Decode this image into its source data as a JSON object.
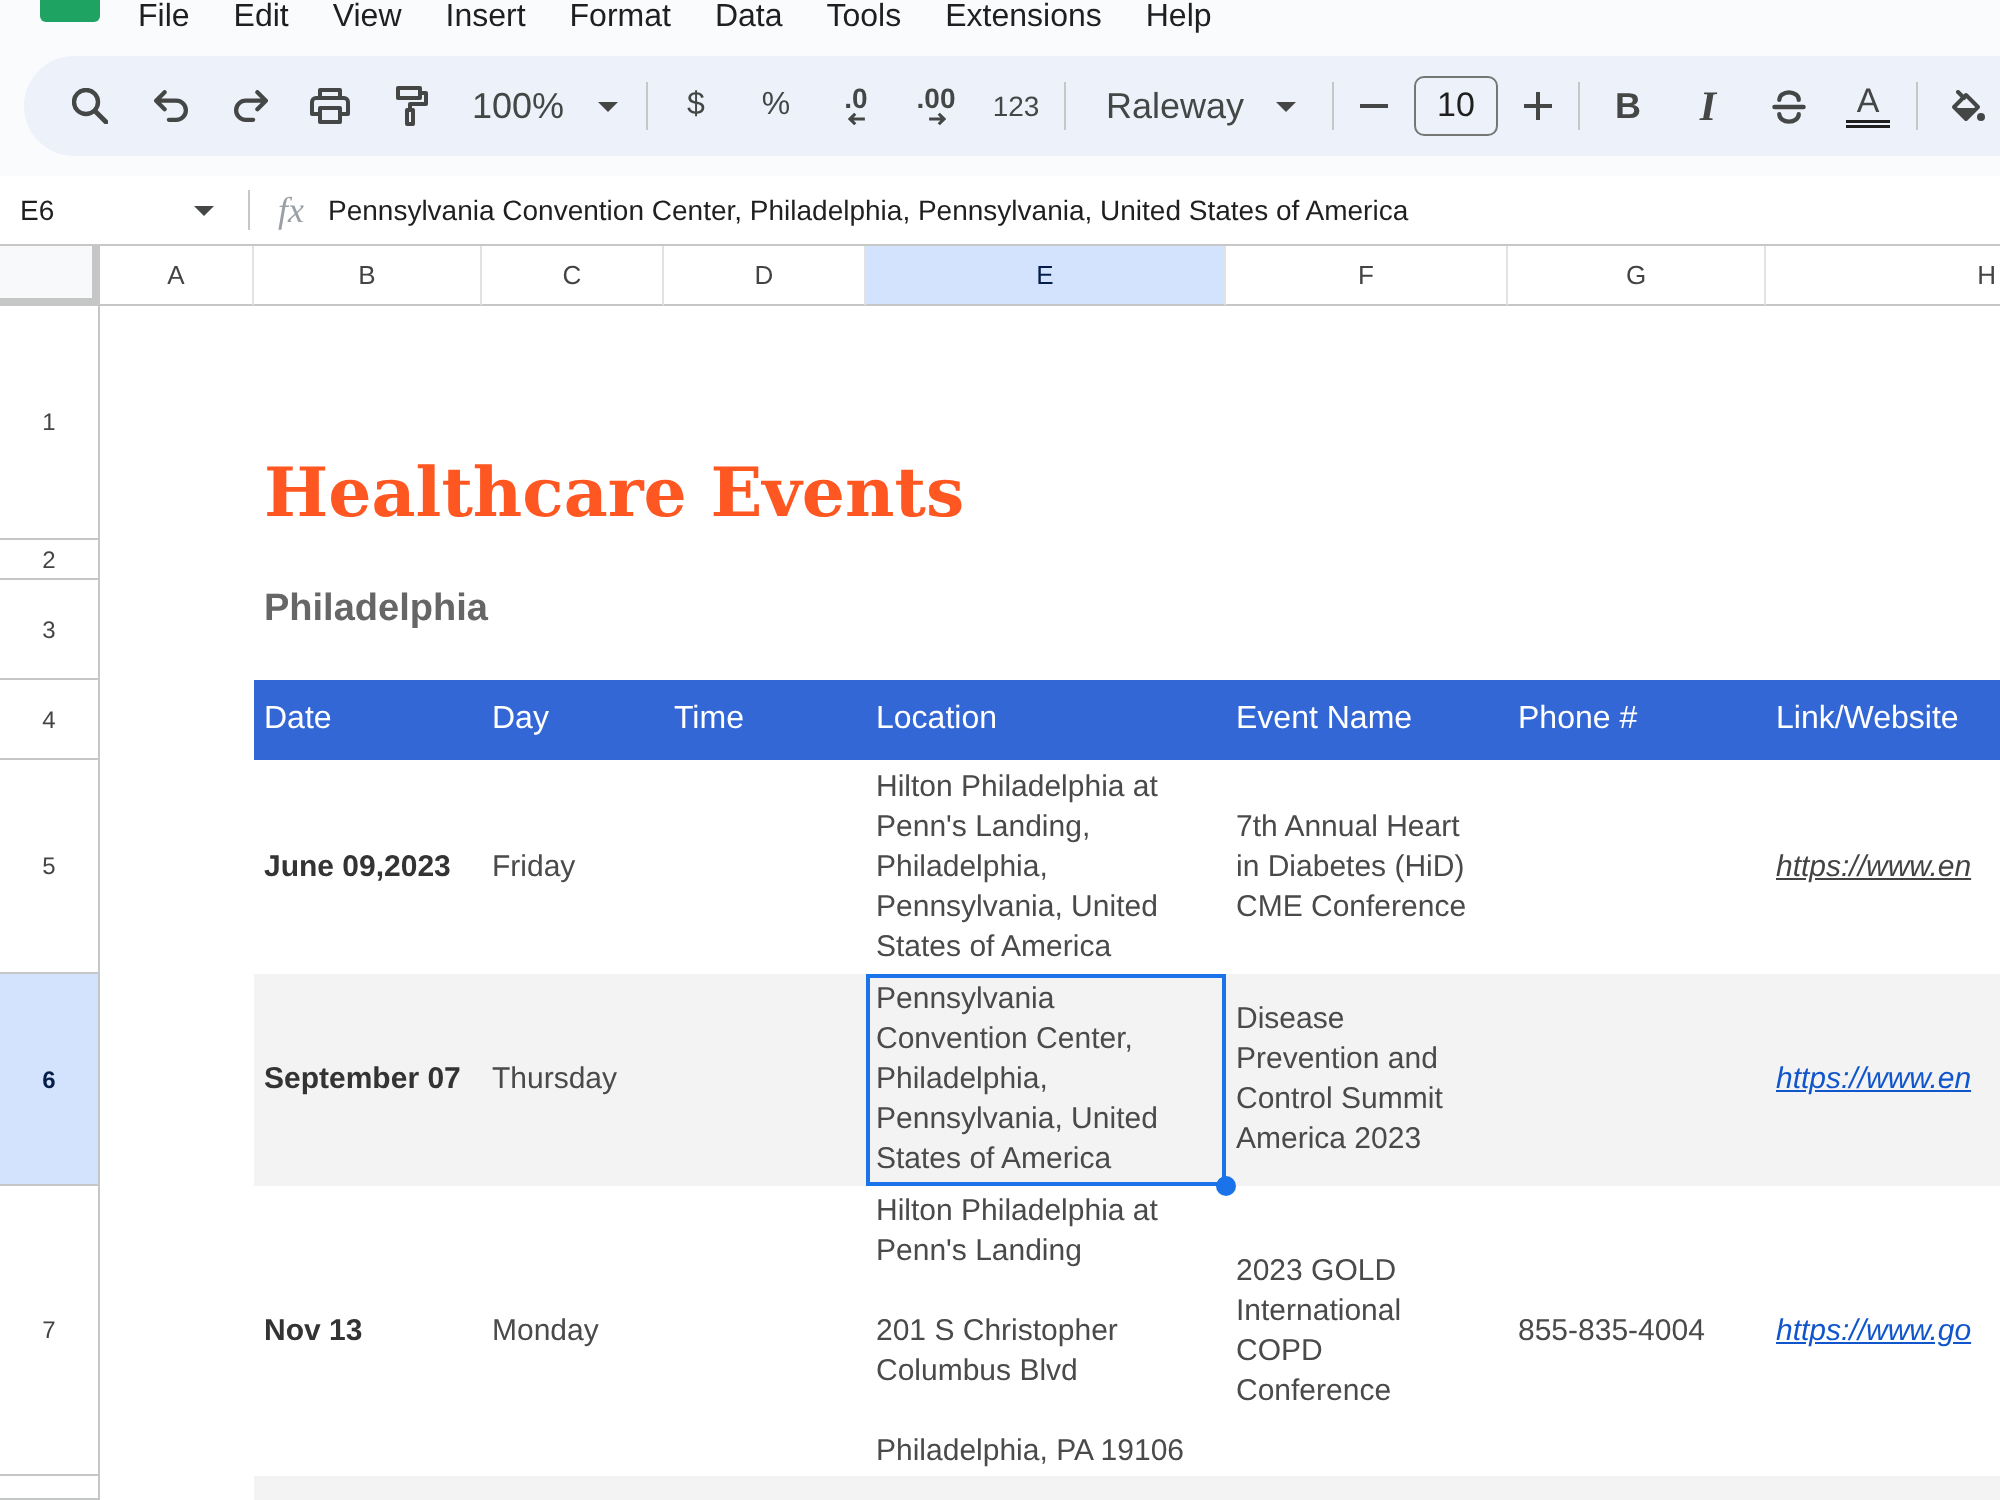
{
  "menu": [
    "File",
    "Edit",
    "View",
    "Insert",
    "Format",
    "Data",
    "Tools",
    "Extensions",
    "Help"
  ],
  "toolbar": {
    "zoom": "100%",
    "currency": "$",
    "percent": "%",
    "decrease_decimal": ".0",
    "increase_decimal": ".00",
    "number_format": "123",
    "font": "Raleway",
    "font_size": "10",
    "bold": "B",
    "italic": "I",
    "text_color": "A"
  },
  "formula_bar": {
    "name_box": "E6",
    "function_label": "fx",
    "formula": "Pennsylvania Convention Center, Philadelphia, Pennsylvania, United States of America"
  },
  "sheet": {
    "columns": [
      {
        "label": "A",
        "selected": false
      },
      {
        "label": "B",
        "selected": false
      },
      {
        "label": "C",
        "selected": false
      },
      {
        "label": "D",
        "selected": false
      },
      {
        "label": "E",
        "selected": true
      },
      {
        "label": "F",
        "selected": false
      },
      {
        "label": "G",
        "selected": false
      },
      {
        "label": "H",
        "selected": false
      }
    ],
    "rows": [
      {
        "label": "1",
        "selected": false
      },
      {
        "label": "2",
        "selected": false
      },
      {
        "label": "3",
        "selected": false
      },
      {
        "label": "4",
        "selected": false
      },
      {
        "label": "5",
        "selected": false
      },
      {
        "label": "6",
        "selected": true
      },
      {
        "label": "7",
        "selected": false
      }
    ],
    "title": "Healthcare Events",
    "subtitle": "Philadelphia",
    "table": {
      "columns": [
        "Date",
        "Day",
        "Time",
        "Location",
        "Event Name",
        "Phone #",
        "Link/Website"
      ],
      "rows": [
        {
          "shaded": false,
          "cells": [
            {
              "kind": "date",
              "text": "June 09,2023",
              "selected": false
            },
            {
              "kind": "text",
              "text": "Friday",
              "selected": false
            },
            {
              "kind": "empty",
              "selected": false
            },
            {
              "kind": "text",
              "text": "Hilton Philadelphia at Penn's Landing, Philadelphia, Pennsylvania, United States of America",
              "selected": false
            },
            {
              "kind": "text",
              "text": "7th Annual Heart in Diabetes (HiD) CME Conference",
              "selected": false
            },
            {
              "kind": "empty",
              "selected": false
            },
            {
              "kind": "link",
              "text": "https://www.en",
              "color": "#434343",
              "selected": false
            }
          ]
        },
        {
          "shaded": true,
          "cells": [
            {
              "kind": "date",
              "text": "September 07",
              "selected": false
            },
            {
              "kind": "text",
              "text": "Thursday",
              "selected": false
            },
            {
              "kind": "empty",
              "selected": false
            },
            {
              "kind": "text",
              "text": "Pennsylvania Convention Center, Philadelphia, Pennsylvania, United States of America",
              "selected": true
            },
            {
              "kind": "text",
              "text": "Disease Prevention and Control Summit America 2023",
              "selected": false
            },
            {
              "kind": "empty",
              "selected": false
            },
            {
              "kind": "link",
              "text": "https://www.en",
              "color": "#1155cc",
              "selected": false
            }
          ]
        },
        {
          "shaded": false,
          "cells": [
            {
              "kind": "date",
              "text": "Nov 13",
              "selected": false
            },
            {
              "kind": "text",
              "text": "Monday",
              "selected": false
            },
            {
              "kind": "empty",
              "selected": false
            },
            {
              "kind": "text",
              "text": "Hilton Philadelphia at Penn's Landing\n\n201 S Christopher Columbus Blvd\n\nPhiladelphia, PA 19106",
              "selected": false
            },
            {
              "kind": "text",
              "text": "2023 GOLD International COPD Conference",
              "selected": false
            },
            {
              "kind": "text",
              "text": "855-835-4004",
              "selected": false
            },
            {
              "kind": "link",
              "text": "https://www.go",
              "color": "#1155cc",
              "selected": false
            }
          ]
        },
        {
          "shaded": true
        }
      ]
    }
  }
}
